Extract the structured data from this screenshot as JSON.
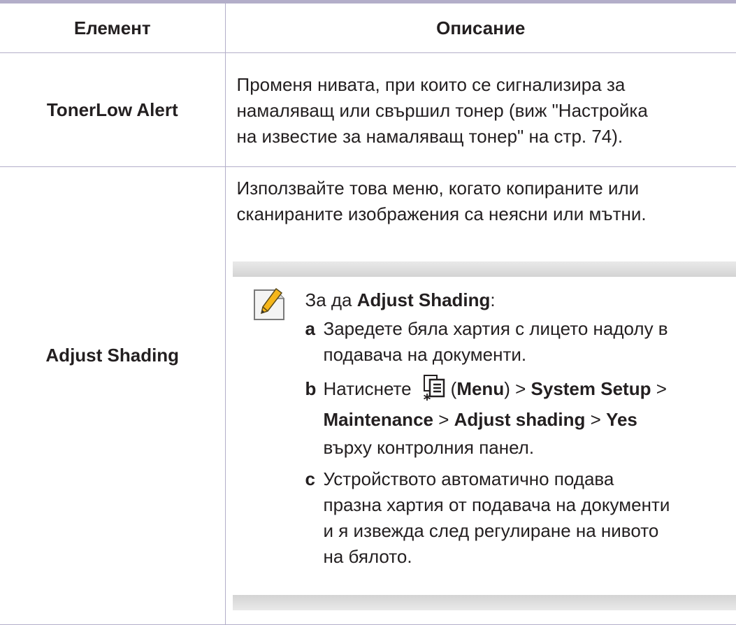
{
  "table": {
    "header": {
      "col1": "Елемент",
      "col2": "Описание"
    },
    "rows": [
      {
        "name": "TonerLow Alert",
        "description_lines": [
          "Променя нивата, при които се сигнализира за",
          "намаляващ или свършил тонер (виж \"Настройка",
          "на известие за намаляващ тонер\" на стр. 74)."
        ]
      },
      {
        "name": "Adjust Shading",
        "description_lines": [
          "Използвайте това меню, когато копираните или",
          "сканираните изображения са неясни или мътни."
        ],
        "note": {
          "icon": "pencil-note-icon",
          "heading_prefix": "За да ",
          "heading_bold": "Adjust Shading",
          "heading_suffix": ":",
          "steps": {
            "a": {
              "letter": "a",
              "line1": "Заредете бяла хартия с лицето надолу в",
              "line2": "подавача на документи."
            },
            "b": {
              "letter": "b",
              "prefix": "Натиснете",
              "menu_icon": "menu-icon",
              "menu_open": "(",
              "menu_label": "Menu",
              "menu_close": ")",
              "sep": " > ",
              "system_setup": "System Setup",
              "maintenance": "Maintenance",
              "adjust_shading": "Adjust shading",
              "yes": "Yes",
              "suffix": "върху контролния панел."
            },
            "c": {
              "letter": "c",
              "line1": "Устройството автоматично подава",
              "line2": "празна хартия от подавача на документи",
              "line3": "и я извежда след регулиране на нивото",
              "line4": "на бялото."
            }
          }
        }
      }
    ]
  },
  "colors": {
    "rule": "#b3aec9",
    "text": "#231f20",
    "note_band": "#dcdcdc"
  }
}
